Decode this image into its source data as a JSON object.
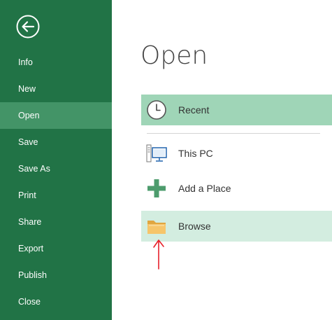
{
  "colors": {
    "sidebar": "#217346",
    "sidebar_active": "#439467",
    "selected_place": "#9fd5b7",
    "hovered_place": "#d3ede0",
    "annotation": "#e8202a"
  },
  "back_icon": "back-arrow-circle-icon",
  "sidebar": {
    "items": [
      {
        "label": "Info",
        "active": false
      },
      {
        "label": "New",
        "active": false
      },
      {
        "label": "Open",
        "active": true
      },
      {
        "label": "Save",
        "active": false
      },
      {
        "label": "Save As",
        "active": false
      },
      {
        "label": "Print",
        "active": false
      },
      {
        "label": "Share",
        "active": false
      },
      {
        "label": "Export",
        "active": false
      },
      {
        "label": "Publish",
        "active": false
      },
      {
        "label": "Close",
        "active": false
      }
    ]
  },
  "main": {
    "title": "Open",
    "places": [
      {
        "label": "Recent",
        "icon": "clock-icon",
        "state": "selected"
      },
      {
        "label": "This PC",
        "icon": "computer-icon",
        "state": "normal"
      },
      {
        "label": "Add a Place",
        "icon": "plus-icon",
        "state": "normal"
      },
      {
        "label": "Browse",
        "icon": "folder-icon",
        "state": "hovered"
      }
    ]
  },
  "annotation": {
    "icon": "red-arrow-up-icon"
  }
}
